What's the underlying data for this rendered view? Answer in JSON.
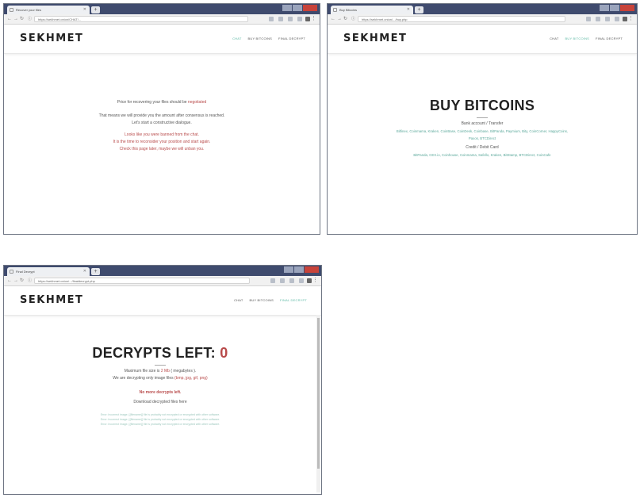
{
  "windows": [
    {
      "tab_title": "Recover your files",
      "url": "https://sekhmet.onion/CHAT/...",
      "logo": "SEKHMET",
      "menu": [
        "CHAT",
        "BUY BITCOINS",
        "FINAL DECRYPT"
      ],
      "content": {
        "line1_pre": "Price for recovering your files should be",
        "line1_link": "negotiated",
        "line2": "That means we will provide you the amount after consensus is reached.",
        "line3": "Let's start a constructive dialogue.",
        "red1": "Looks like you were banned from the chat.",
        "red2": "It is the time to reconsider your position and start again.",
        "red3": "Check this page later, maybe we will unban you."
      }
    },
    {
      "tab_title": "Buy Bitcoins",
      "url": "https://sekhmet.onion/.../buy.php",
      "logo": "SEKHMET",
      "menu": [
        "CHAT",
        "BUY BITCOINS",
        "FINAL DECRYPT"
      ],
      "content": {
        "title": "BUY BITCOINS",
        "bank_label": "Bank account / Transfer",
        "bank_list_1": "Bitfinex, Coinmama, Kraken, CoinBase, CoinDesk, Coinbase, BitPanda, Paymium, Bity, CoinCorner, HappyCoins,",
        "bank_list_2": "Paxos, BTCDirect",
        "card_label": "Credit / Debit Card",
        "card_list": "BitPanda, CEX.io, Coinhouse, Coinmama, Safello, Kraken, BitStamp, BTCDirect, CoinCafe"
      }
    },
    {
      "tab_title": "Final Decrypt",
      "url": "https://sekhmet.onion/.../finaldecrypt.php",
      "logo": "SEKHMET",
      "menu": [
        "CHAT",
        "BUY BITCOINS",
        "FINAL DECRYPT"
      ],
      "content": {
        "title_pre": "DECRYPTS LEFT:",
        "title_count": "0",
        "max_size_pre": "Maximum file size is",
        "max_size_val": "2 Mb",
        "max_size_post": "( megabytes ).",
        "types_pre": "We are decrypting only image files",
        "types_val": "(bmp, jpg, gif, png)",
        "no_more": "No more decrypts left.",
        "download": "Download decrypted files here",
        "errors": [
          "Error: Incorrect image. [{filename}] file is probably not encrypted or encrypted with other software.",
          "Error: Incorrect image. [{filename}] file is probably not encrypted or encrypted with other software.",
          "Error: Incorrect image. [{filename}] file is probably not encrypted or encrypted with other software."
        ]
      }
    }
  ],
  "colors": {
    "titlebar": "#3f4b6e",
    "accent": "#5cb8a4",
    "red": "#b84a4a"
  }
}
